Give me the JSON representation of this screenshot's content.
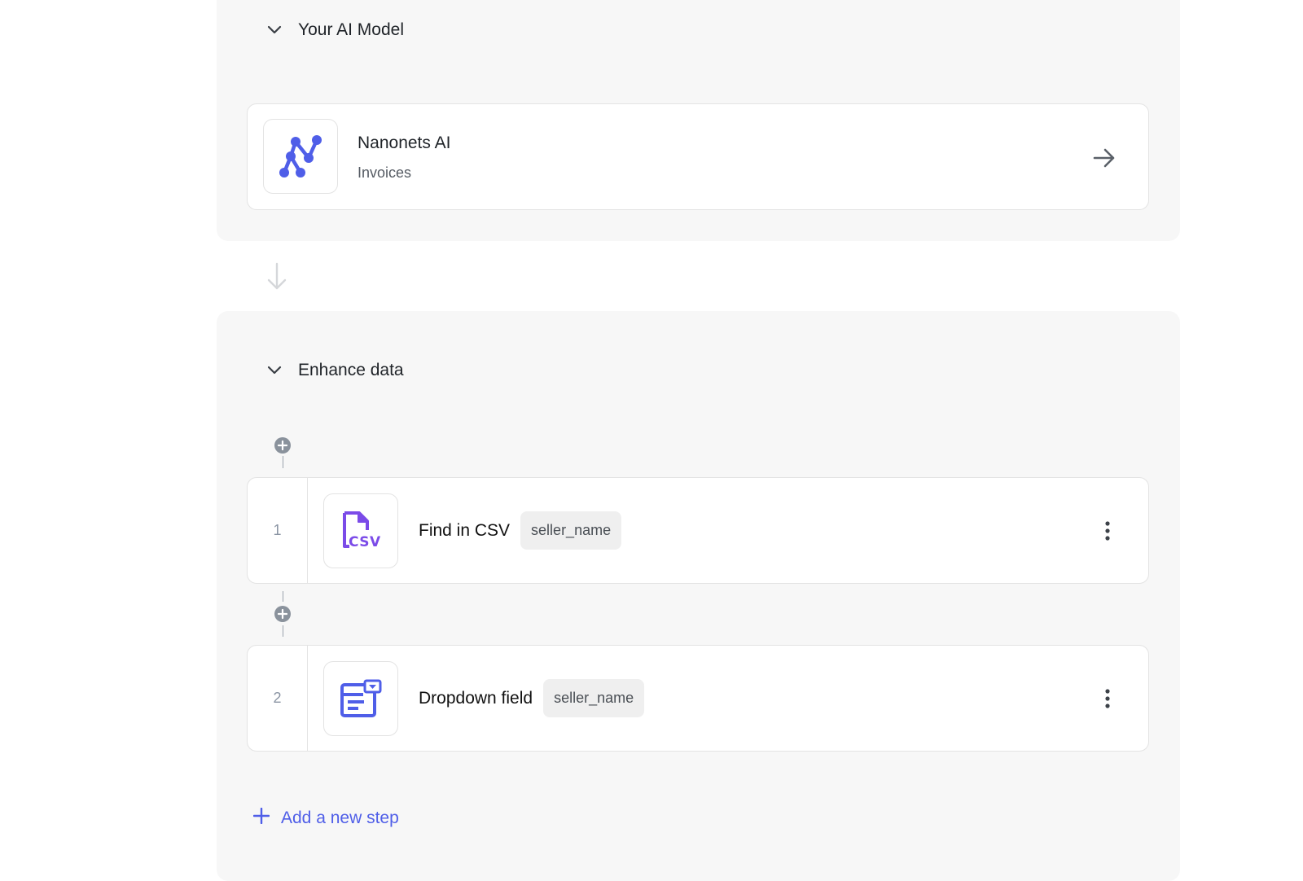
{
  "ai_model_section": {
    "title": "Your AI Model",
    "model": {
      "name": "Nanonets AI",
      "subtitle": "Invoices"
    }
  },
  "enhance_section": {
    "title": "Enhance data",
    "steps": [
      {
        "number": "1",
        "title": "Find in CSV",
        "field": "seller_name",
        "icon": "csv-file-icon"
      },
      {
        "number": "2",
        "title": "Dropdown field",
        "field": "seller_name",
        "icon": "dropdown-form-icon"
      }
    ],
    "add_step_label": "Add a new step"
  },
  "colors": {
    "accent": "#4f5ee8",
    "panel_bg": "#f7f7f7",
    "csv_purple": "#7b4be8"
  }
}
